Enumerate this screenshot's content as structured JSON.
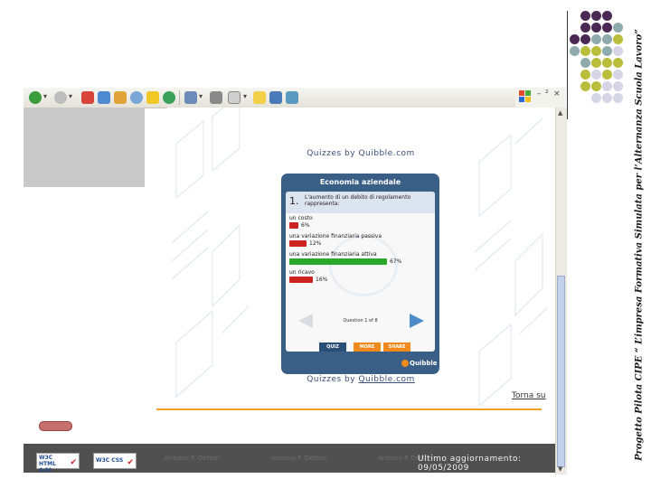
{
  "side_caption": "Progetto Pilota CIPE “ L’impresa Formativa Simulata per l’Alternanza Scuola Lavoro”",
  "dot_colors": {
    "purple": "#4a2a55",
    "teal": "#8faaad",
    "lime": "#b9bd3c",
    "lavender": "#d5d5e6"
  },
  "toolbar": {
    "icons": [
      "back-icon",
      "forward-icon",
      "stop-icon",
      "refresh-icon",
      "home-icon",
      "search-icon",
      "favorites-icon",
      "history-icon",
      "mail-icon",
      "print-icon",
      "edit-icon",
      "discuss-icon",
      "messenger-icon",
      "research-icon"
    ],
    "window_controls": {
      "minimize": "–",
      "restore": "²",
      "close": "×"
    }
  },
  "quizzes_by": "Quizzes by",
  "quizzes_brand": "Quibble.com",
  "quiz": {
    "title": "Economia aziendale",
    "question_number": "1.",
    "question_text": "L'aumento di un debito di regolamento rappresenta:",
    "options": [
      {
        "label": "un costo",
        "percent": "6%",
        "value": 6,
        "color": "#cc2222"
      },
      {
        "label": "una variazione finanziaria passiva",
        "percent": "12%",
        "value": 12,
        "color": "#cc2222"
      },
      {
        "label": "una variazione finanziaria attiva",
        "percent": "67%",
        "value": 67,
        "color": "#2aa82a"
      },
      {
        "label": "un ricavo",
        "percent": "16%",
        "value": 16,
        "color": "#cc2222"
      }
    ],
    "counter": "Question 1 of 8",
    "tabs": {
      "quiz": "QUIZ",
      "more": "MORE",
      "share": "SHARE"
    },
    "logo": "Quibble"
  },
  "torna_su": "Torna su",
  "footer": {
    "w3c_html": "W3C HTML 4.01",
    "w3c_css": "W3C CSS",
    "author": "Antonio P. Dettori",
    "last_update": "Ultimo aggiornamento: 09/05/2009"
  }
}
